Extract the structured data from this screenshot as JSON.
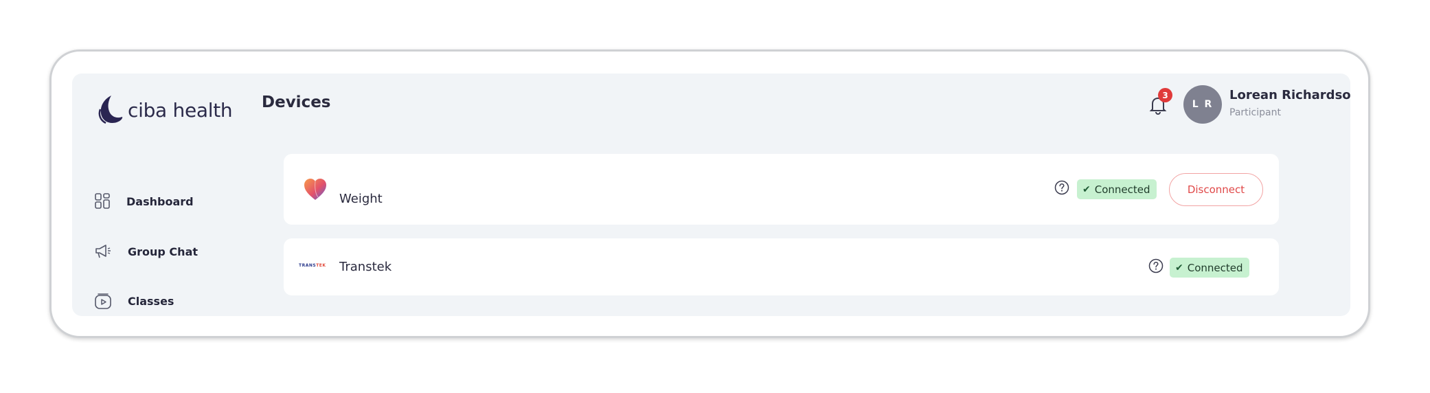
{
  "app": {
    "logo_text": "ciba health",
    "page_title": "Devices"
  },
  "header": {
    "notifications_count": "3",
    "avatar_initials": "L R",
    "user_name": "Lorean Richardson",
    "user_role": "Participant"
  },
  "sidebar": {
    "items": [
      {
        "label": "Dashboard",
        "icon": "dashboard-icon"
      },
      {
        "label": "Group Chat",
        "icon": "megaphone-icon"
      },
      {
        "label": "Classes",
        "icon": "play-card-icon"
      }
    ]
  },
  "devices": [
    {
      "name": "Weight",
      "status": "Connected",
      "action": "Disconnect",
      "icon": "heart-icon"
    },
    {
      "name": "Transtek",
      "status": "Connected",
      "logo_text_a": "TRANS",
      "logo_text_b": "TEK"
    }
  ],
  "colors": {
    "accent": "#2b2a4a",
    "connected_bg": "#c7f1d0",
    "disconnect": "#e04848",
    "badge": "#e03a3a",
    "app_bg": "#f1f4f7"
  }
}
